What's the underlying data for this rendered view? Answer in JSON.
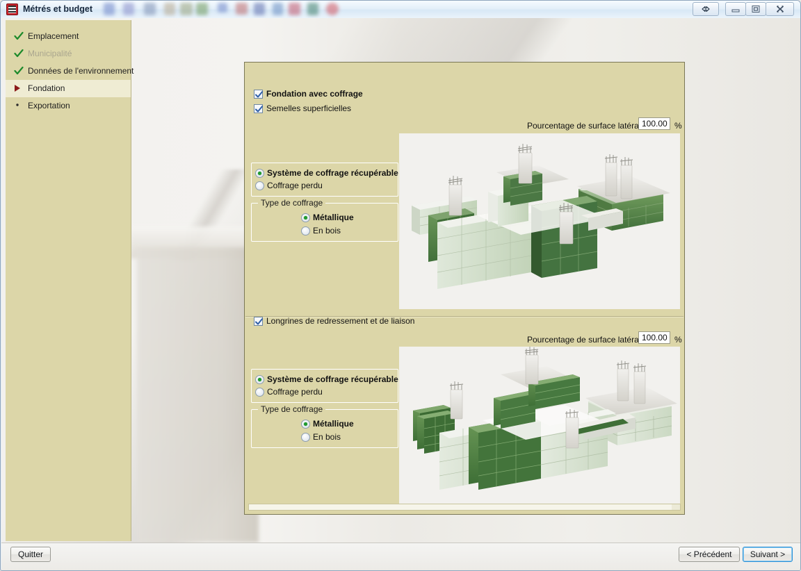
{
  "window": {
    "title": "Métrés et budget",
    "icon": "app-icon",
    "controls": [
      {
        "name": "resize-button",
        "glyph": "double-arrow"
      },
      {
        "name": "minimize-button",
        "glyph": "minimize"
      },
      {
        "name": "restore-button",
        "glyph": "restore"
      },
      {
        "name": "close-button",
        "glyph": "close"
      }
    ]
  },
  "sidebar": {
    "items": [
      {
        "label": "Emplacement",
        "state": "done",
        "mark": "check-icon"
      },
      {
        "label": "Municipalité",
        "state": "done-disabled",
        "mark": "check-icon"
      },
      {
        "label": "Données de l'environnement",
        "state": "done",
        "mark": "check-icon"
      },
      {
        "label": "Fondation",
        "state": "active",
        "mark": "arrow-right-icon"
      },
      {
        "label": "Exportation",
        "state": "pending",
        "mark": "dot-icon"
      }
    ]
  },
  "form": {
    "main_checkbox": {
      "label": "Fondation avec coffrage",
      "checked": true
    },
    "sections": [
      {
        "id": "semelles",
        "checkbox": {
          "label": "Semelles superficielles",
          "checked": true
        },
        "percent": {
          "label": "Pourcentage de surface latérale",
          "value": "100.00",
          "unit": "%"
        },
        "formwork_system": {
          "options": [
            {
              "label": "Système de coffrage récupérable",
              "selected": true
            },
            {
              "label": "Coffrage perdu",
              "selected": false
            }
          ]
        },
        "formwork_type": {
          "title": "Type de coffrage",
          "options": [
            {
              "label": "Métallique",
              "selected": true
            },
            {
              "label": "En bois",
              "selected": false
            }
          ]
        },
        "preview": {
          "name": "foundation-footings-3d-preview",
          "alt": "Vue 3D des semelles superficielles avec coffrage métallique"
        }
      },
      {
        "id": "longrines",
        "checkbox": {
          "label": "Longrines de redressement et de liaison",
          "checked": true
        },
        "percent": {
          "label": "Pourcentage de surface latérale",
          "value": "100.00",
          "unit": "%"
        },
        "formwork_system": {
          "options": [
            {
              "label": "Système de coffrage récupérable",
              "selected": true
            },
            {
              "label": "Coffrage perdu",
              "selected": false
            }
          ]
        },
        "formwork_type": {
          "title": "Type de coffrage",
          "options": [
            {
              "label": "Métallique",
              "selected": true
            },
            {
              "label": "En bois",
              "selected": false
            }
          ]
        },
        "preview": {
          "name": "foundation-beams-3d-preview",
          "alt": "Vue 3D des longrines de redressement et de liaison avec coffrage"
        }
      }
    ]
  },
  "footer": {
    "quit_label": "Quitter",
    "previous_label": "< Précédent",
    "next_label": "Suivant >"
  },
  "colors": {
    "sidebar_bg": "#dcd6a8",
    "sidebar_active_bg": "#efecd3",
    "panel_bg": "#dcd6a8",
    "panel_border": "#7a7755",
    "check_green": "#1d8a2b",
    "radio_green": "#1f9b2e",
    "arrow_red": "#8b1a1a",
    "default_button_blue": "#2a8fd6",
    "image_bg": "#f2f1ee",
    "concrete": "#d9d7d2",
    "formwork_green_light": "#c9d8c0",
    "formwork_green_dark": "#4f7a42"
  }
}
